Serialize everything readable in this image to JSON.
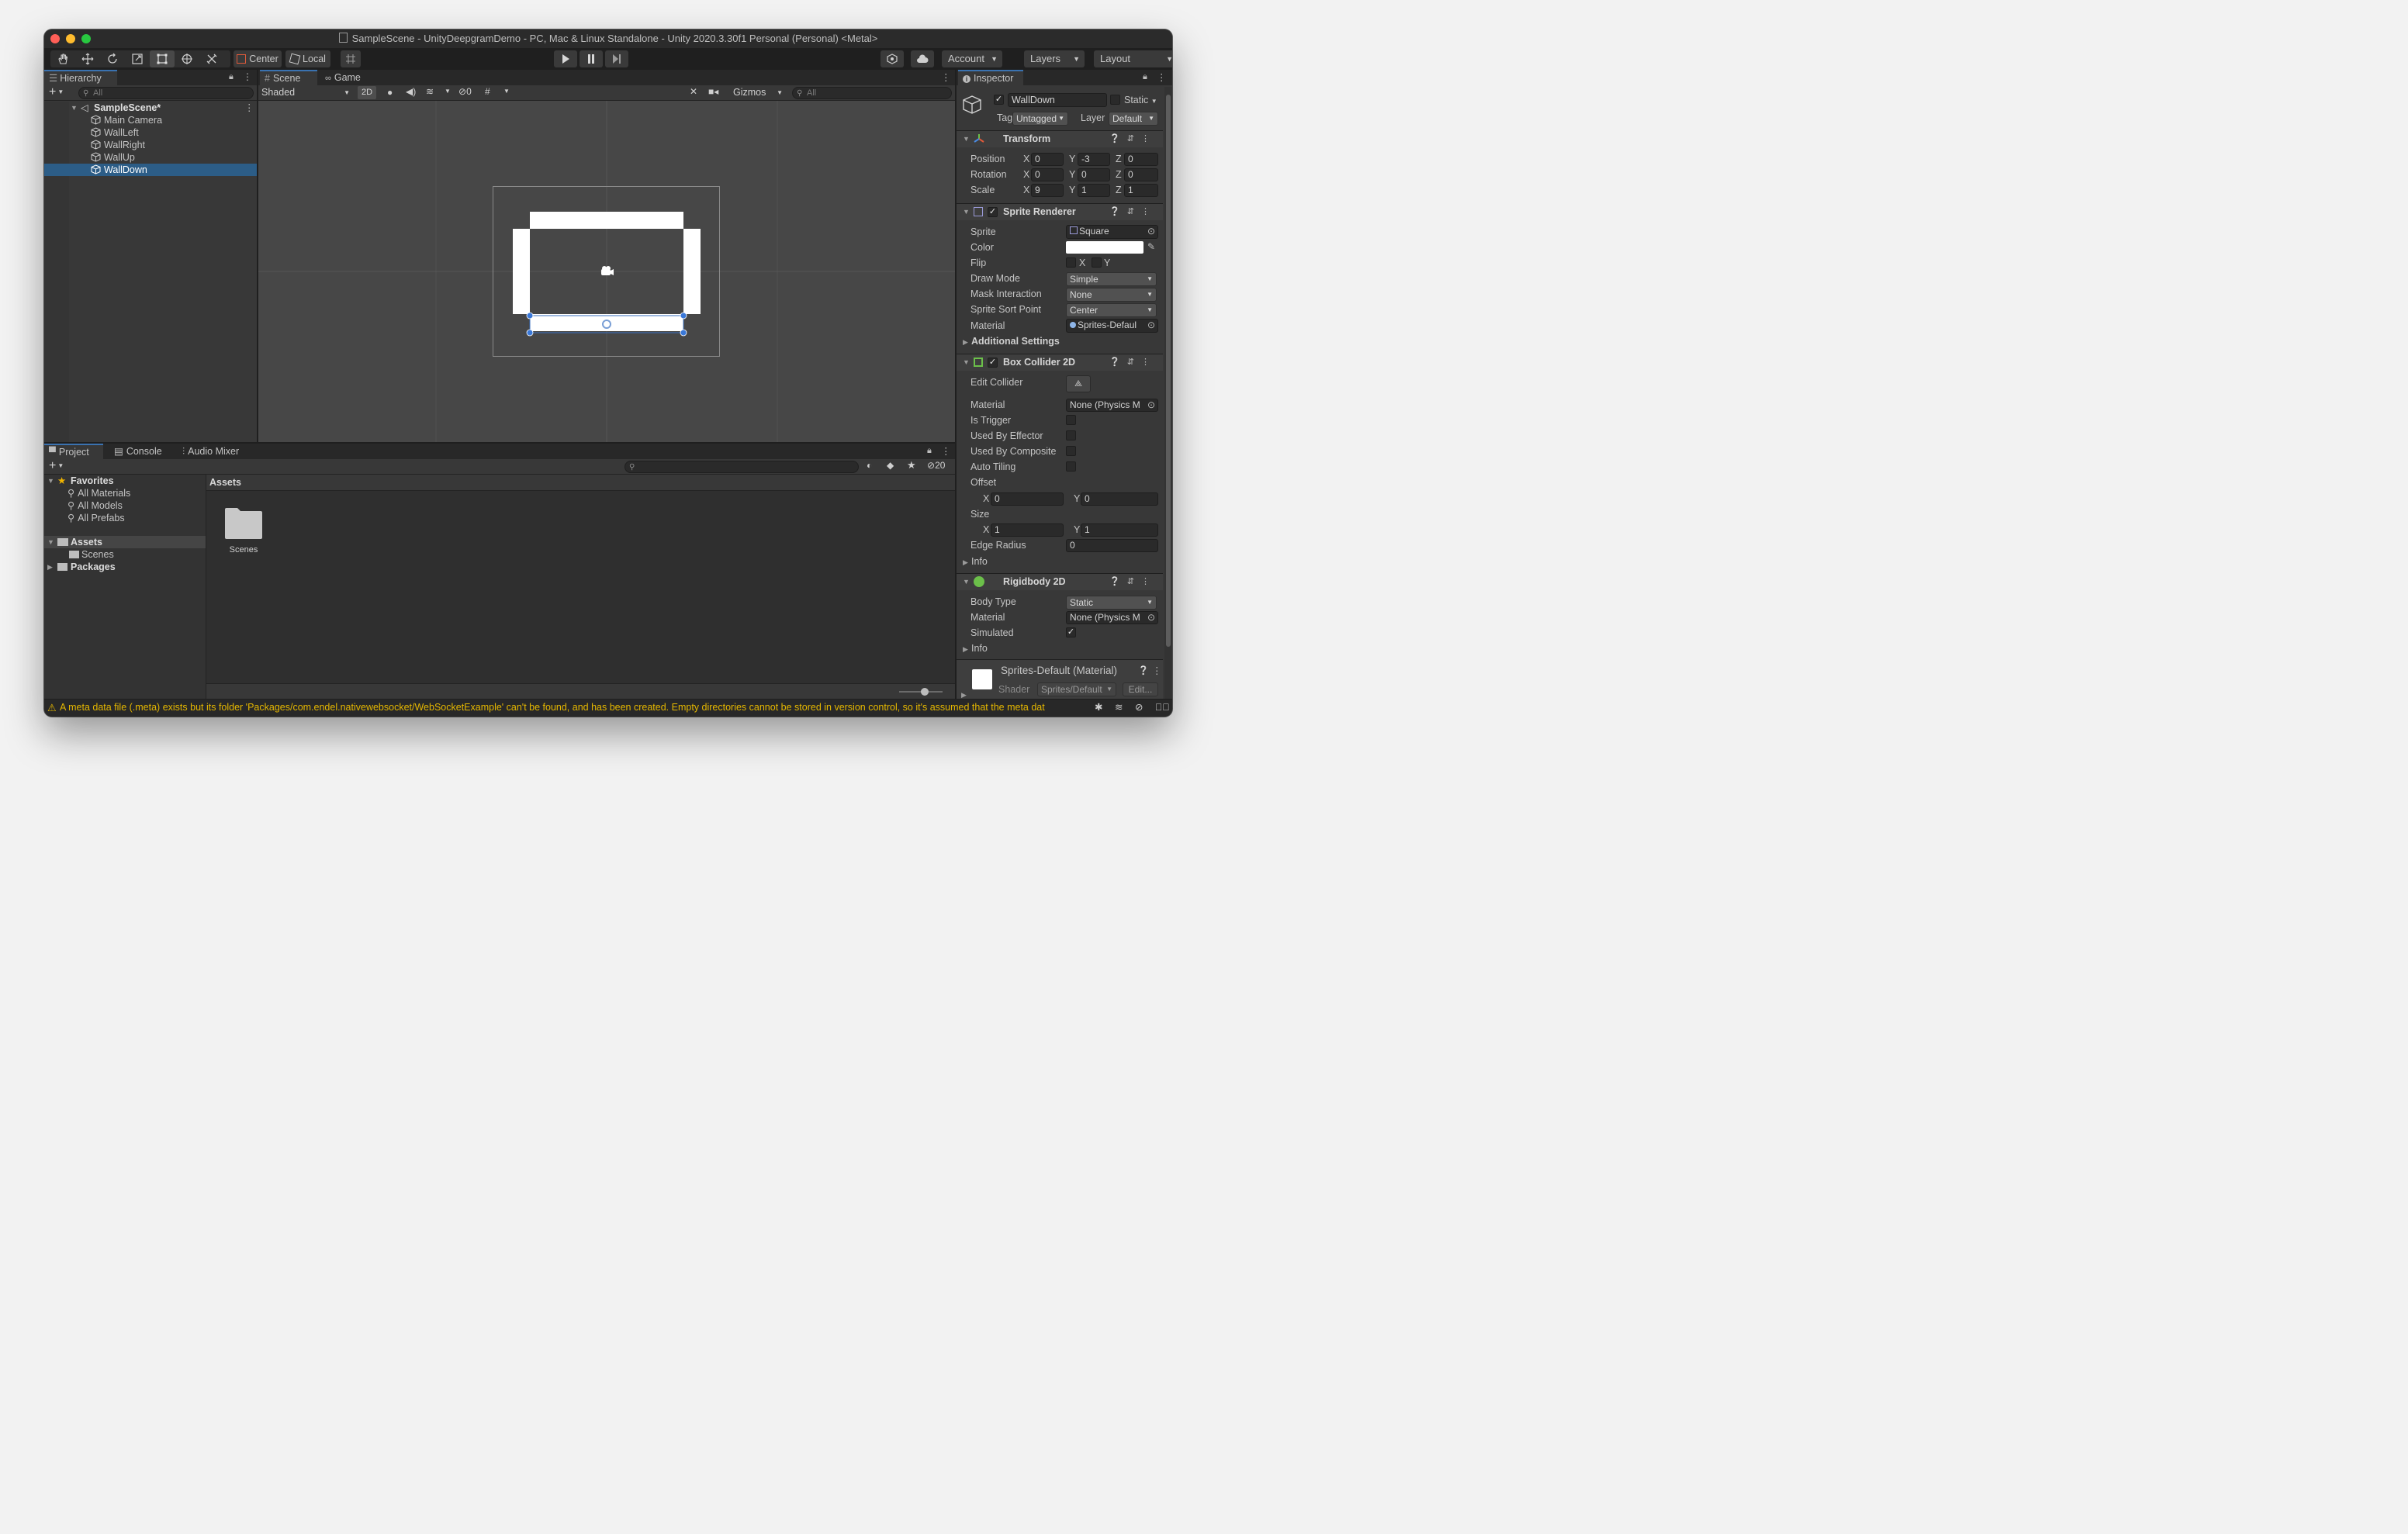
{
  "window": {
    "title": "SampleScene - UnityDeepgramDemo - PC, Mac & Linux Standalone - Unity 2020.3.30f1 Personal (Personal) <Metal>"
  },
  "toolbar": {
    "pivot_label": "Center",
    "space_label": "Local",
    "account_label": "Account",
    "layers_label": "Layers",
    "layout_label": "Layout"
  },
  "hierarchy": {
    "tab_label": "Hierarchy",
    "search_placeholder": "All",
    "scene_name": "SampleScene*",
    "items": [
      {
        "label": "Main Camera"
      },
      {
        "label": "WallLeft"
      },
      {
        "label": "WallRight"
      },
      {
        "label": "WallUp"
      },
      {
        "label": "WallDown"
      }
    ],
    "selected": "WallDown"
  },
  "scene_view": {
    "tabs": [
      "Scene",
      "Game"
    ],
    "shading_mode": "Shaded",
    "mode_2d": "2D",
    "hidden_count": "0",
    "gizmos_label": "Gizmos",
    "search_placeholder": "All"
  },
  "project": {
    "tabs": [
      "Project",
      "Console",
      "Audio Mixer"
    ],
    "hidden_count": "20",
    "favorites_label": "Favorites",
    "favorites": [
      "All Materials",
      "All Models",
      "All Prefabs"
    ],
    "assets_label": "Assets",
    "assets_children": [
      "Scenes"
    ],
    "packages_label": "Packages",
    "breadcrumb": "Assets",
    "grid_items": [
      {
        "label": "Scenes"
      }
    ]
  },
  "inspector": {
    "tab_label": "Inspector",
    "object_name": "WallDown",
    "static_label": "Static",
    "tag_label": "Tag",
    "tag_value": "Untagged",
    "layer_label": "Layer",
    "layer_value": "Default",
    "transform": {
      "title": "Transform",
      "position_label": "Position",
      "position": {
        "x": "0",
        "y": "-3",
        "z": "0"
      },
      "rotation_label": "Rotation",
      "rotation": {
        "x": "0",
        "y": "0",
        "z": "0"
      },
      "scale_label": "Scale",
      "scale": {
        "x": "9",
        "y": "1",
        "z": "1"
      }
    },
    "sprite_renderer": {
      "title": "Sprite Renderer",
      "sprite_label": "Sprite",
      "sprite_value": "Square",
      "color_label": "Color",
      "color_value": "#ffffff",
      "flip_label": "Flip",
      "flip_x": "X",
      "flip_y": "Y",
      "draw_mode_label": "Draw Mode",
      "draw_mode_value": "Simple",
      "mask_label": "Mask Interaction",
      "mask_value": "None",
      "sort_point_label": "Sprite Sort Point",
      "sort_point_value": "Center",
      "material_label": "Material",
      "material_value": "Sprites-Defaul",
      "additional_settings": "Additional Settings"
    },
    "box_collider": {
      "title": "Box Collider 2D",
      "edit_collider_label": "Edit Collider",
      "material_label": "Material",
      "material_value": "None (Physics M",
      "is_trigger_label": "Is Trigger",
      "used_by_effector_label": "Used By Effector",
      "used_by_composite_label": "Used By Composite",
      "auto_tiling_label": "Auto Tiling",
      "offset_label": "Offset",
      "offset": {
        "x": "0",
        "y": "0"
      },
      "size_label": "Size",
      "size": {
        "x": "1",
        "y": "1"
      },
      "edge_radius_label": "Edge Radius",
      "edge_radius": "0",
      "info_label": "Info"
    },
    "rigidbody": {
      "title": "Rigidbody 2D",
      "body_type_label": "Body Type",
      "body_type_value": "Static",
      "material_label": "Material",
      "material_value": "None (Physics M",
      "simulated_label": "Simulated",
      "simulated": true,
      "info_label": "Info"
    },
    "material_preview": {
      "title": "Sprites-Default (Material)",
      "shader_label": "Shader",
      "shader_value": "Sprites/Default",
      "edit_label": "Edit..."
    }
  },
  "status": {
    "message": "A meta data file (.meta) exists but its folder 'Packages/com.endel.nativewebsocket/WebSocketExample' can't be found, and has been created. Empty directories cannot be stored in version control, so it's assumed that the meta dat"
  },
  "colors": {
    "accent": "#2c5d87",
    "warning": "#e5b700",
    "close": "#ff5f57",
    "minimize": "#febc2e",
    "maximize": "#28c840"
  }
}
